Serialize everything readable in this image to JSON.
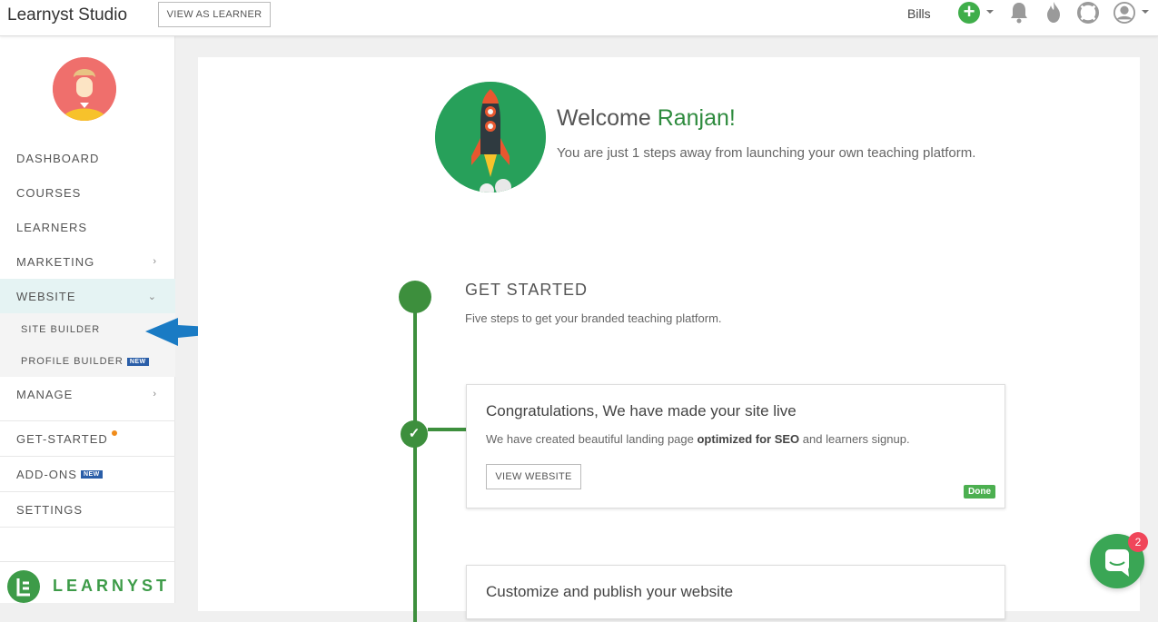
{
  "header": {
    "brand": "Learnyst Studio",
    "view_as_learner": "VIEW AS LEARNER",
    "bills": "Bills",
    "icons": [
      "plus-icon",
      "bell-icon",
      "flame-icon",
      "lifebuoy-icon",
      "user-icon"
    ]
  },
  "sidebar": {
    "items": [
      {
        "label": "DASHBOARD"
      },
      {
        "label": "COURSES"
      },
      {
        "label": "LEARNERS"
      },
      {
        "label": "MARKETING"
      },
      {
        "label": "WEBSITE"
      },
      {
        "label": "SITE BUILDER"
      },
      {
        "label": "PROFILE BUILDER",
        "badge": "NEW"
      },
      {
        "label": "MANAGE"
      },
      {
        "label": "GET-STARTED"
      },
      {
        "label": "ADD-ONS",
        "badge": "NEW"
      },
      {
        "label": "SETTINGS"
      }
    ],
    "logo_text": "LEARNYST"
  },
  "main": {
    "welcome_prefix": "Welcome ",
    "welcome_name": "Ranjan!",
    "subtitle": "You are just 1 steps away from launching your own teaching platform.",
    "get_started_title": "GET STARTED",
    "get_started_sub": "Five steps to get your branded teaching platform.",
    "steps": [
      {
        "title": "Congratulations, We have made your site live",
        "desc_prefix": "We have created beautiful landing page ",
        "desc_bold": "optimized for SEO",
        "desc_suffix": " and learners signup.",
        "button": "VIEW WEBSITE",
        "status": "Done"
      },
      {
        "title": "Customize and publish your website"
      }
    ]
  },
  "chat": {
    "badge_count": "2"
  },
  "colors": {
    "accent_green": "#3d8f3d",
    "brand_green": "#27a05a",
    "badge_blue": "#2a5ea8"
  }
}
